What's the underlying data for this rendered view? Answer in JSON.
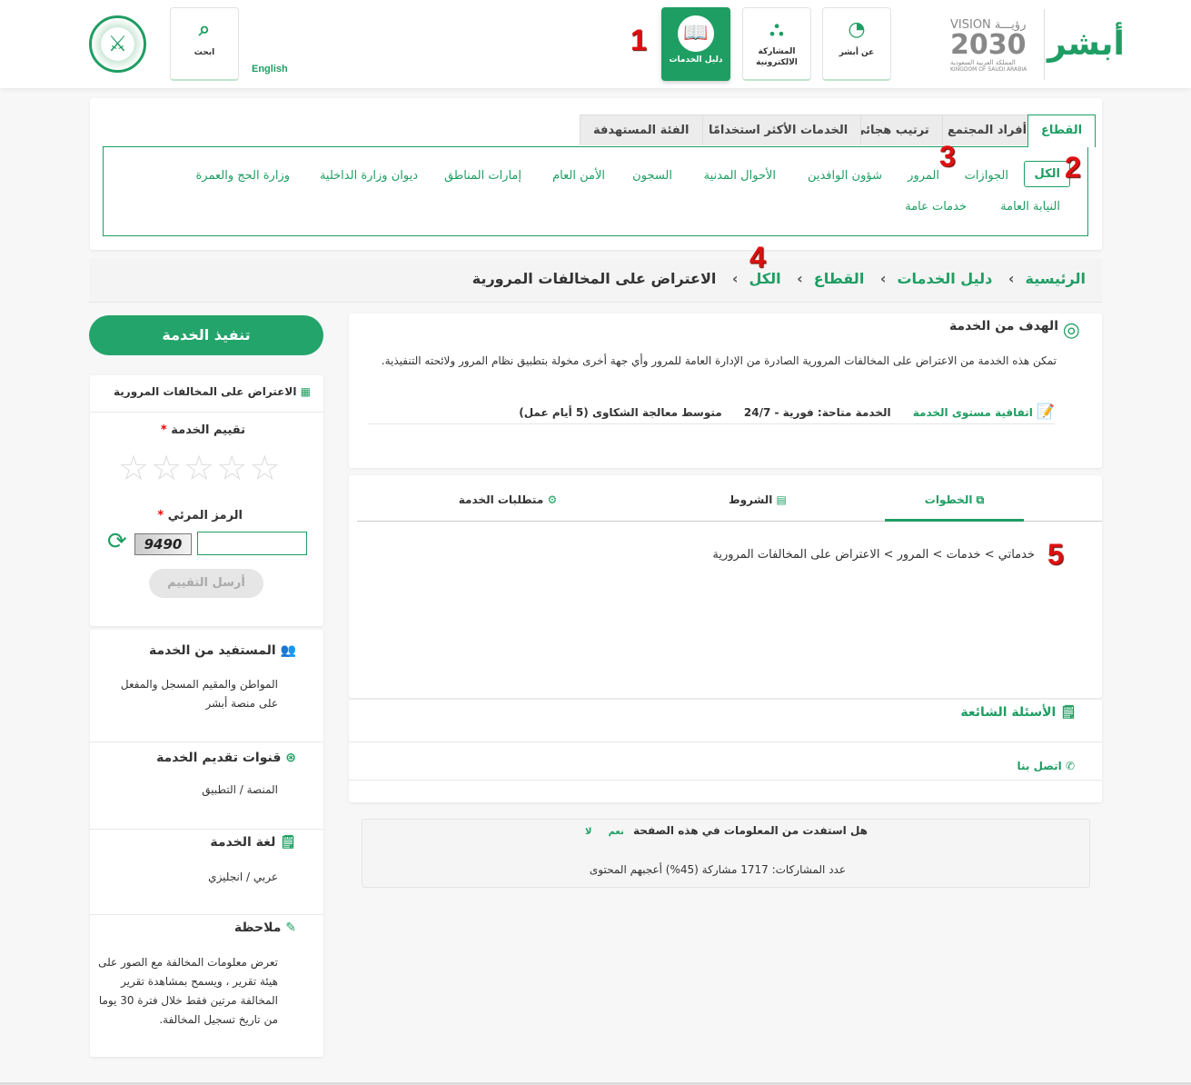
{
  "header": {
    "english": "English",
    "search": "ابحث",
    "nav": [
      {
        "label": "عن أبشر",
        "icon": "cursor-circle-icon"
      },
      {
        "label": "المشاركة الالكترونية",
        "icon": "share-network-icon"
      },
      {
        "label": "دليل الخدمات",
        "icon": "book-icon",
        "active": true
      }
    ],
    "logo_text": "أبشر",
    "vision": {
      "title": "VISION رؤيـــة",
      "year": "2030",
      "sub_ar": "المملكة العربية السعودية",
      "sub_en": "KINGDOM OF SAUDI ARABIA"
    }
  },
  "annotations": [
    "1",
    "2",
    "3",
    "4",
    "5"
  ],
  "filter": {
    "tabs": [
      "القطاع",
      "أفراد المجتمع",
      "ترتيب هجائي",
      "الخدمات الأكثر استخدامًا",
      "الفئة المستهدفة"
    ],
    "items": [
      "الكل",
      "الجوازات",
      "المرور",
      "شؤون الوافدين",
      "الأحوال المدنية",
      "السجون",
      "الأمن العام",
      "إمارات المناطق",
      "ديوان وزارة الداخلية",
      "وزارة الحج والعمرة",
      "النيابة العامة",
      "خدمات عامة"
    ]
  },
  "breadcrumb": [
    "الرئيسية",
    "دليل الخدمات",
    "القطاع",
    "الكل",
    "الاعتراض على المخالفات المرورية"
  ],
  "goal": {
    "title": "الهدف من الخدمة",
    "text": "تمكن هذه الخدمة من الاعتراض على المخالفات المرورية الصادرة من الإدارة العامة للمرور وأي جهة أخرى مخولة بتطبيق نظام المرور ولائحته التنفيذية.",
    "sla_label": "اتفاقية مستوى الخدمة",
    "availability": "الخدمة متاحة: فورية - 24/7",
    "complaints": "متوسط معالجة الشكاوى (5 أيام عمل)"
  },
  "tabs": {
    "items": [
      "الخطوات",
      "الشروط",
      "متطلبات الخدمة"
    ],
    "steps_path": "خدماتي > خدمات > المرور > الاعتراض على المخالفات المرورية"
  },
  "faq": "الأسئلة الشائعة",
  "contact": "اتصل بنا",
  "feedback": {
    "question": "هل استفدت من المعلومات في هذه الصفحة",
    "yes": "نعم",
    "no": "لا",
    "stats": "عدد المشاركات: 1717 مشاركة (45%) أعجبهم المحتوى"
  },
  "sidebar": {
    "execute": "تنفيذ الخدمة",
    "service_name": "الاعتراض على المخالفات المرورية",
    "rating_label": "تقييم الخدمة",
    "rating": 0,
    "captcha_label": "الرمز المرئي",
    "captcha": "9490",
    "captcha_value": "",
    "submit": "أرسل التقييم",
    "required": "*",
    "sections": [
      {
        "title": "المستفيد من الخدمة",
        "text": "المواطن والمقيم المسجل والمفعل على منصة أبشر",
        "icon": "users-icon"
      },
      {
        "title": "قنوات تقديم الخدمة",
        "text": "المنصة / التطبيق",
        "icon": "channels-icon"
      },
      {
        "title": "لغة الخدمة",
        "text": "عربي / انجليزي",
        "icon": "certificate-icon"
      },
      {
        "title": "ملاحظة",
        "text": "تعرض معلومات المخالفة مع الصور على هيئة تقرير ، ويسمح بمشاهدة تقرير المخالفة مرتين فقط خلال فترة 30 يوما من تاريخ تسجيل المخالفة.",
        "icon": "note-edit-icon"
      }
    ]
  },
  "colors": {
    "brand": "#1f9e63",
    "annotation": "#dd1111"
  }
}
